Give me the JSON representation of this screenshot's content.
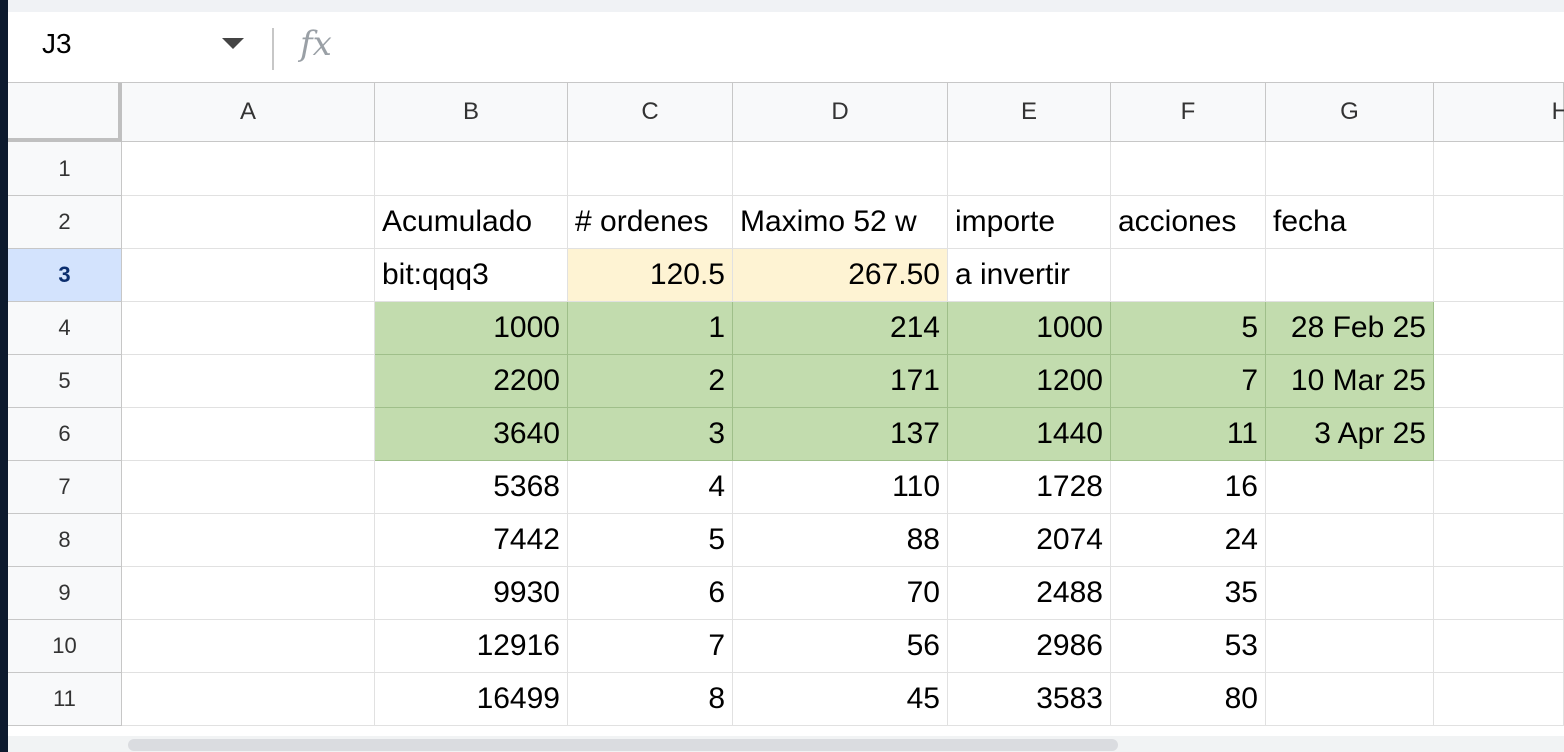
{
  "namebox": {
    "value": "J3"
  },
  "formula": {
    "icon": "fx-icon",
    "fx_label": "fx"
  },
  "columns": [
    "A",
    "B",
    "C",
    "D",
    "E",
    "F",
    "G",
    "H"
  ],
  "rows": [
    "1",
    "2",
    "3",
    "4",
    "5",
    "6",
    "7",
    "8",
    "9",
    "10",
    "11"
  ],
  "active_row": "3",
  "cells": {
    "r2": {
      "B": "Acumulado",
      "C": "# ordenes",
      "D": "Maximo 52 w",
      "E": "importe",
      "F": "acciones",
      "G": "fecha"
    },
    "r3": {
      "B": "bit:qqq3",
      "C": "120.5",
      "D": "267.50",
      "E": "a invertir"
    },
    "r4": {
      "B": "1000",
      "C": "1",
      "D": "214",
      "E": "1000",
      "F": "5",
      "G": "28 Feb 25"
    },
    "r5": {
      "B": "2200",
      "C": "2",
      "D": "171",
      "E": "1200",
      "F": "7",
      "G": "10 Mar 25"
    },
    "r6": {
      "B": "3640",
      "C": "3",
      "D": "137",
      "E": "1440",
      "F": "11",
      "G": "3 Apr 25"
    },
    "r7": {
      "B": "5368",
      "C": "4",
      "D": "110",
      "E": "1728",
      "F": "16"
    },
    "r8": {
      "B": "7442",
      "C": "5",
      "D": "88",
      "E": "2074",
      "F": "24"
    },
    "r9": {
      "B": "9930",
      "C": "6",
      "D": "70",
      "E": "2488",
      "F": "35"
    },
    "r10": {
      "B": "12916",
      "C": "7",
      "D": "56",
      "E": "2986",
      "F": "53"
    },
    "r11": {
      "B": "16499",
      "C": "8",
      "D": "45",
      "E": "3583",
      "F": "80"
    }
  },
  "colors": {
    "green_fill": "#c2dcae",
    "yellow_fill": "#fef3d3",
    "active_row_header": "#d3e3fd"
  }
}
